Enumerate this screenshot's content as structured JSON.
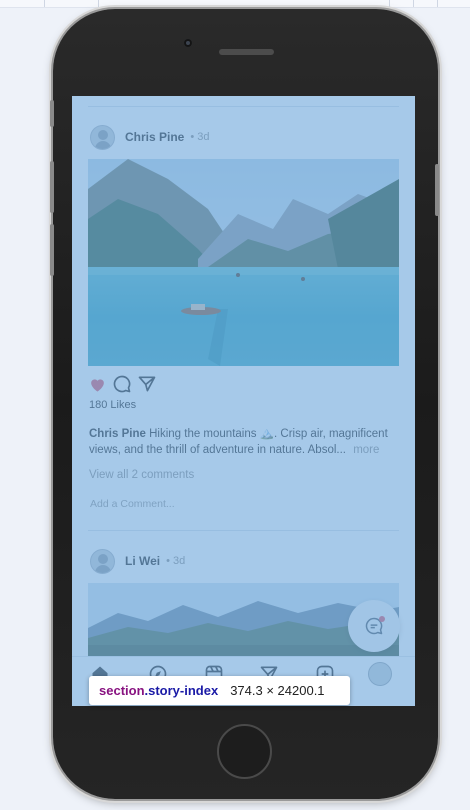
{
  "posts": [
    {
      "author": "Chris Pine",
      "time": "• 3d"
    },
    {
      "author": "Li Wei",
      "time": "• 3d"
    }
  ],
  "post1": {
    "likes": "180 Likes",
    "caption_author": "Chris Pine",
    "caption_text": "Hiking the mountains 🏔️. Crisp air, magnificent views, and the thrill of adventure in nature. Absol...",
    "more": "more",
    "view_comments": "View all 2 comments",
    "add_comment_placeholder": "Add a Comment..."
  },
  "inspector": {
    "tag": "section",
    "class": ".story-index",
    "dimensions": "374.3 × 24200.1"
  },
  "icons": {
    "like": "heart-icon",
    "comment": "comment-icon",
    "share": "send-icon",
    "fab": "chat-icon",
    "nav": [
      "home-icon",
      "explore-icon",
      "reels-icon",
      "send-icon",
      "add-icon"
    ]
  },
  "colors": {
    "overlay": "#6fa8dc",
    "like": "#e0566a",
    "tag": "#881280",
    "class": "#1a1aa6"
  }
}
